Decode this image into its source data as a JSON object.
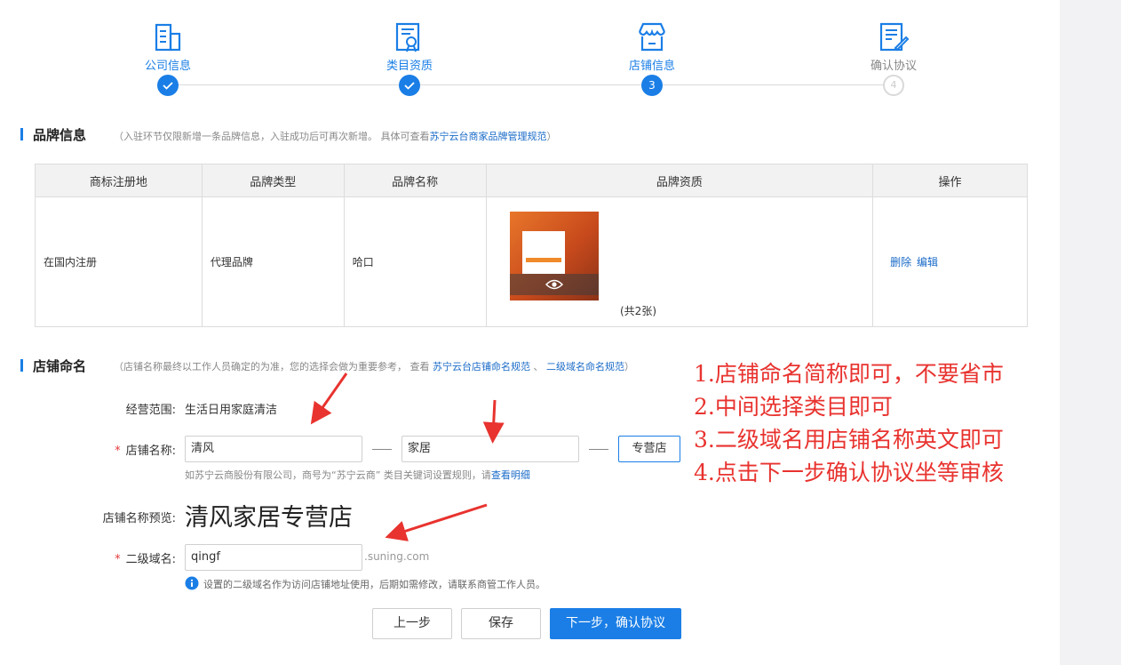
{
  "steps": [
    {
      "label": "公司信息",
      "state": "done",
      "icon": "building-icon"
    },
    {
      "label": "类目资质",
      "state": "done",
      "icon": "certificate-icon"
    },
    {
      "label": "店铺信息",
      "state": "current",
      "number": "3",
      "icon": "store-icon"
    },
    {
      "label": "确认协议",
      "state": "pending",
      "number": "4",
      "icon": "contract-icon"
    }
  ],
  "brand_section": {
    "title": "品牌信息",
    "note_prefix": "（入驻环节仅限新增一条品牌信息，入驻成功后可再次新增。 具体可查看",
    "note_link": "苏宁云台商家品牌管理规范",
    "note_suffix": "）",
    "columns": [
      "商标注册地",
      "品牌类型",
      "品牌名称",
      "品牌资质",
      "操作"
    ],
    "row": {
      "registration": "在国内注册",
      "type": "代理品牌",
      "name": "哈口",
      "qual_count": "(共2张)",
      "delete": "删除",
      "edit": "编辑"
    }
  },
  "shop_section": {
    "title": "店铺命名",
    "note_prefix": "（店铺名称最终以工作人员确定的为准，您的选择会做为重要参考， 查看 ",
    "note_link1": "苏宁云台店铺命名规范",
    "note_sep": " 、 ",
    "note_link2": "二级域名命名规范",
    "note_suffix": "）"
  },
  "form": {
    "scope_label": "经营范围:",
    "scope_value": "生活日用家庭清洁",
    "name_label": "店铺名称:",
    "name_part1": "清风",
    "name_part2": "家居",
    "name_type": "专营店",
    "name_hint_prefix": "如苏宁云商股份有限公司，商号为“苏宁云商”   类目关键词设置规则，请",
    "name_hint_link": "查看明细",
    "preview_label": "店铺名称预览:",
    "preview_value": "清风家居专营店",
    "domain_label": "二级域名:",
    "domain_value": "qingf",
    "domain_suffix": ".suning.com",
    "domain_hint": "设置的二级域名作为访问店铺地址使用，后期如需修改，请联系商管工作人员。",
    "required_mark": "*"
  },
  "buttons": {
    "prev": "上一步",
    "save": "保存",
    "next": "下一步，确认协议"
  },
  "annotations": [
    "1.店铺命名简称即可，不要省市",
    "2.中间选择类目即可",
    "3.二级域名用店铺名称英文即可",
    "4.点击下一步确认协议坐等审核"
  ],
  "colors": {
    "accent": "#1a7ee6",
    "annotation": "#e8332f"
  }
}
